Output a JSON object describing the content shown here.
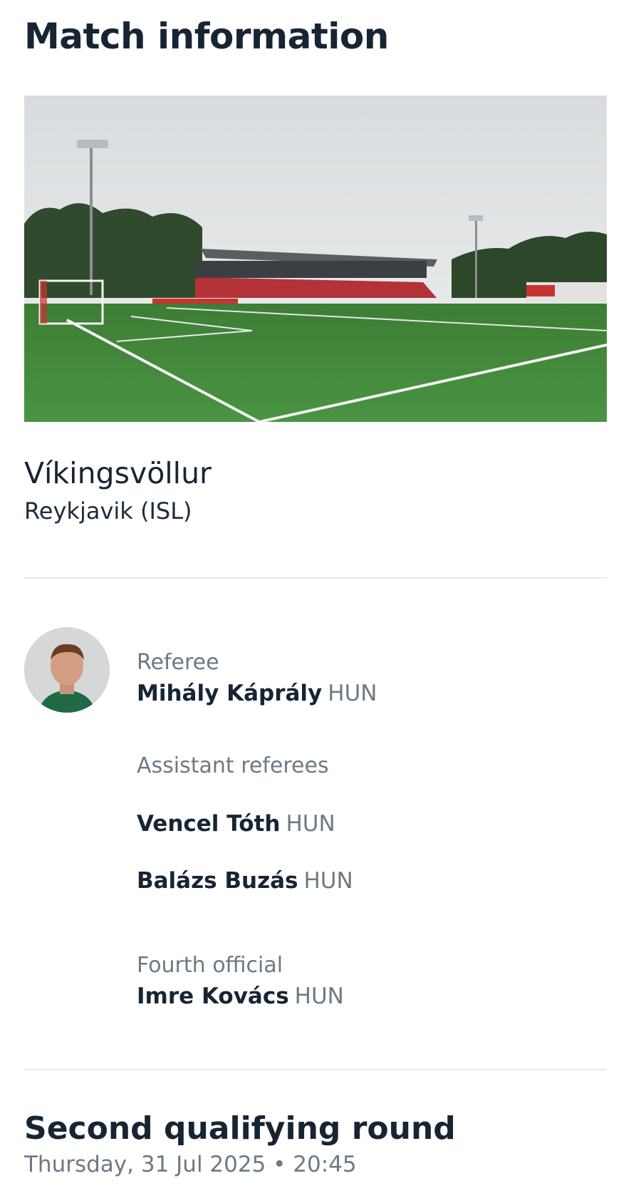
{
  "page": {
    "title": "Match information"
  },
  "venue": {
    "photo_icon": "stadium-photo",
    "name": "Víkingsvöllur",
    "city": "Reykjavik (ISL)"
  },
  "officials": {
    "referee": {
      "label": "Referee",
      "name": "Mihály Káprály",
      "nat": "HUN"
    },
    "assistants": {
      "label": "Assistant referees",
      "people": [
        {
          "name": "Vencel Tóth",
          "nat": "HUN"
        },
        {
          "name": "Balázs Buzás",
          "nat": "HUN"
        }
      ]
    },
    "fourth": {
      "label": "Fourth official",
      "name": "Imre Kovács",
      "nat": "HUN"
    }
  },
  "match": {
    "round": "Second qualifying round",
    "datetime": "Thursday, 31 Jul 2025 • 20:45"
  },
  "colors": {
    "text_dark": "#172533",
    "text_muted": "#6d7983",
    "pitch": "#3f8a3a",
    "stand": "#c8353a"
  }
}
